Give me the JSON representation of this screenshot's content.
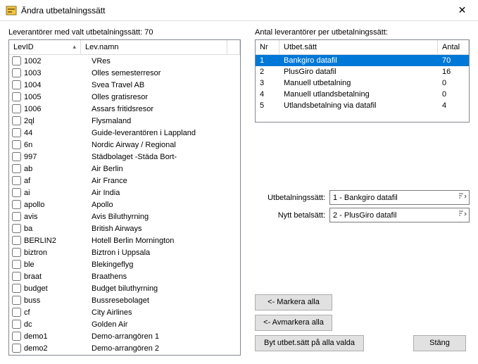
{
  "window": {
    "title": "Ändra utbetalningssätt"
  },
  "left": {
    "label_prefix": "Leverantörer med valt utbetalningssätt:",
    "count": "70",
    "headers": {
      "id": "LevID",
      "name": "Lev.namn"
    },
    "rows": [
      {
        "id": "1002",
        "name": "VRes"
      },
      {
        "id": "1003",
        "name": "Olles semesterresor"
      },
      {
        "id": "1004",
        "name": "Svea Travel  AB"
      },
      {
        "id": "1005",
        "name": "Olles gratisresor"
      },
      {
        "id": "1006",
        "name": "Assars fritidsresor"
      },
      {
        "id": "2ql",
        "name": "Flysmaland"
      },
      {
        "id": "44",
        "name": "Guide-leverantören i Lappland"
      },
      {
        "id": "6n",
        "name": "Nordic Airway / Regional"
      },
      {
        "id": "997",
        "name": "Städbolaget -Städa Bort-"
      },
      {
        "id": "ab",
        "name": "Air Berlin"
      },
      {
        "id": "af",
        "name": "Air France"
      },
      {
        "id": "ai",
        "name": "Air India"
      },
      {
        "id": "apollo",
        "name": "Apollo"
      },
      {
        "id": "avis",
        "name": "Avis Biluthyrning"
      },
      {
        "id": "ba",
        "name": "British Airways"
      },
      {
        "id": "BERLIN2",
        "name": "Hotell Berlin Mornington"
      },
      {
        "id": "biztron",
        "name": "Biztron i Uppsala"
      },
      {
        "id": "ble",
        "name": "Blekingeflyg"
      },
      {
        "id": "braat",
        "name": "Braathens"
      },
      {
        "id": "budget",
        "name": "Budget biluthyrning"
      },
      {
        "id": "buss",
        "name": "Bussresebolaget"
      },
      {
        "id": "cf",
        "name": "City Airlines"
      },
      {
        "id": "dc",
        "name": "Golden Air"
      },
      {
        "id": "demo1",
        "name": "Demo-arrangören 1"
      },
      {
        "id": "demo2",
        "name": "Demo-arrangören 2"
      }
    ]
  },
  "right": {
    "label": "Antal leverantörer per utbetalningssätt:",
    "headers": {
      "nr": "Nr",
      "satt": "Utbet.sätt",
      "antal": "Antal"
    },
    "rows": [
      {
        "nr": "1",
        "satt": "Bankgiro datafil",
        "antal": "70",
        "selected": true
      },
      {
        "nr": "2",
        "satt": "PlusGiro datafil",
        "antal": "16"
      },
      {
        "nr": "3",
        "satt": "Manuell utbetalning",
        "antal": "0"
      },
      {
        "nr": "4",
        "satt": "Manuell utlandsbetalning",
        "antal": "0"
      },
      {
        "nr": "5",
        "satt": "Utlandsbetalning via datafil",
        "antal": "4"
      }
    ]
  },
  "fields": {
    "utbet_label": "Utbetalningssätt:",
    "utbet_value": "1  - Bankgiro datafil",
    "nytt_label": "Nytt betalsätt:",
    "nytt_value": "2  - PlusGiro datafil"
  },
  "buttons": {
    "mark_all": "<- Markera alla",
    "unmark_all": "<- Avmarkera alla",
    "change_all": "Byt utbet.sätt på alla valda",
    "close": "Stäng"
  }
}
